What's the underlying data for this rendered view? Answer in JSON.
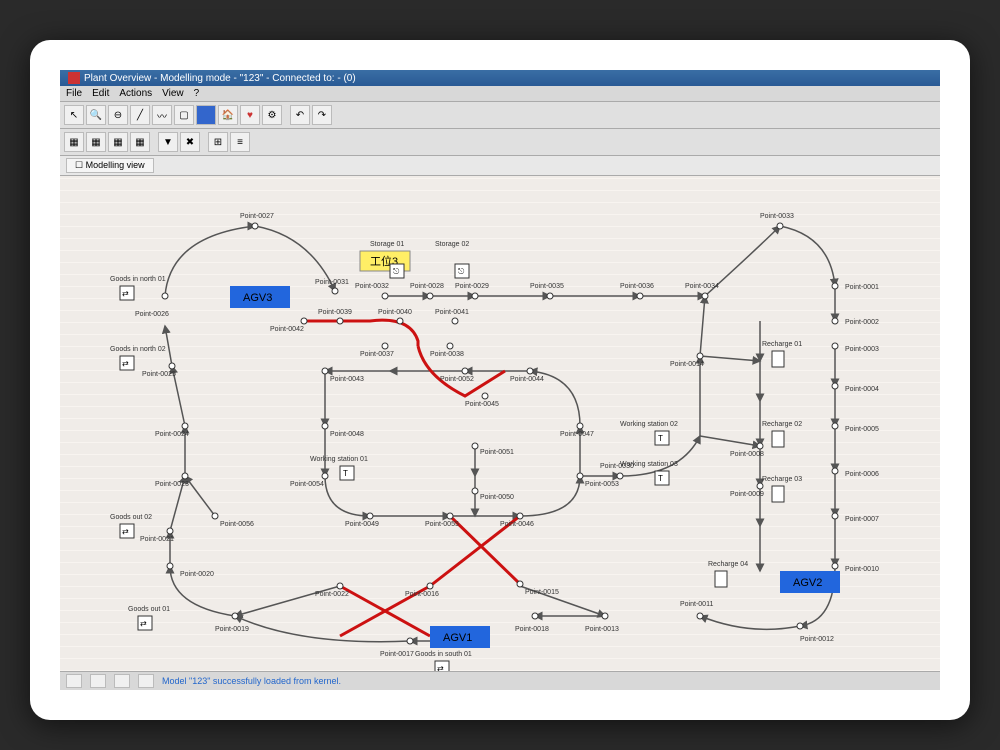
{
  "window": {
    "title": "Plant Overview - Modelling mode - \"123\" - Connected to: - (0)"
  },
  "menu": {
    "file": "File",
    "edit": "Edit",
    "actions": "Actions",
    "view": "View",
    "help": "?"
  },
  "viewtab": {
    "label": "Modelling view"
  },
  "agvs": {
    "agv1": "AGV1",
    "agv2": "AGV2",
    "agv3": "AGV3"
  },
  "yellowLabel": "工位3",
  "stations": {
    "storage01": "Storage 01",
    "storage02": "Storage 02",
    "goodsInNorth01": "Goods in north 01",
    "goodsInNorth02": "Goods in north 02",
    "goodsOut01": "Goods out 01",
    "goodsOut02": "Goods out 02",
    "goodsInSouth01": "Goods in south 01",
    "workingStation01": "Working station 01",
    "workingStation02": "Working station 02",
    "workingStation03": "Working station 03",
    "recharge01": "Recharge 01",
    "recharge02": "Recharge 02",
    "recharge03": "Recharge 03",
    "recharge04": "Recharge 04"
  },
  "points": {
    "p1": "Point-0001",
    "p2": "Point-0002",
    "p3": "Point-0003",
    "p4": "Point-0004",
    "p5": "Point-0005",
    "p6": "Point-0006",
    "p7": "Point-0007",
    "p8": "Point-0008",
    "p9": "Point-0009",
    "p10": "Point-0010",
    "p11": "Point-0011",
    "p12": "Point-0012",
    "p13": "Point-0013",
    "p14": "Point-0014",
    "p15": "Point-0015",
    "p16": "Point-0016",
    "p17": "Point-0017",
    "p18": "Point-0018",
    "p19": "Point-0019",
    "p20": "Point-0020",
    "p21": "Point-0021",
    "p22": "Point-0022",
    "p23": "Point-0023",
    "p24": "Point-0024",
    "p25": "Point-0025",
    "p26": "Point-0026",
    "p27": "Point-0027",
    "p28": "Point-0028",
    "p29": "Point-0029",
    "p30": "Point-0030",
    "p31": "Point-0031",
    "p32": "Point-0032",
    "p33": "Point-0033",
    "p34": "Point-0034",
    "p35": "Point-0035",
    "p36": "Point-0036",
    "p37": "Point-0037",
    "p38": "Point-0038",
    "p39": "Point-0039",
    "p40": "Point-0040",
    "p41": "Point-0041",
    "p42": "Point-0042",
    "p43": "Point-0043",
    "p44": "Point-0044",
    "p45": "Point-0045",
    "p46": "Point-0046",
    "p47": "Point-0047",
    "p48": "Point-0048",
    "p49": "Point-0049",
    "p50": "Point-0050",
    "p51": "Point-0051",
    "p52": "Point-0052",
    "p53": "Point-0053",
    "p54": "Point-0054",
    "p55": "Point-0055",
    "p56": "Point-0056"
  },
  "status": {
    "text": "Model \"123\" successfully loaded from kernel."
  }
}
